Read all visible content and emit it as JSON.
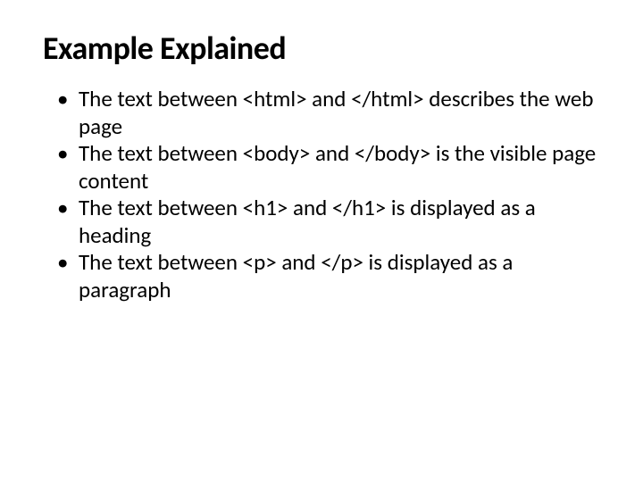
{
  "title": "Example Explained",
  "bullets": [
    "The text between <html> and </html> describes the web page",
    "The text between <body> and </body> is the visible page content",
    "The text between <h1> and </h1> is displayed as a heading",
    "The text between <p> and </p> is displayed as a paragraph"
  ]
}
